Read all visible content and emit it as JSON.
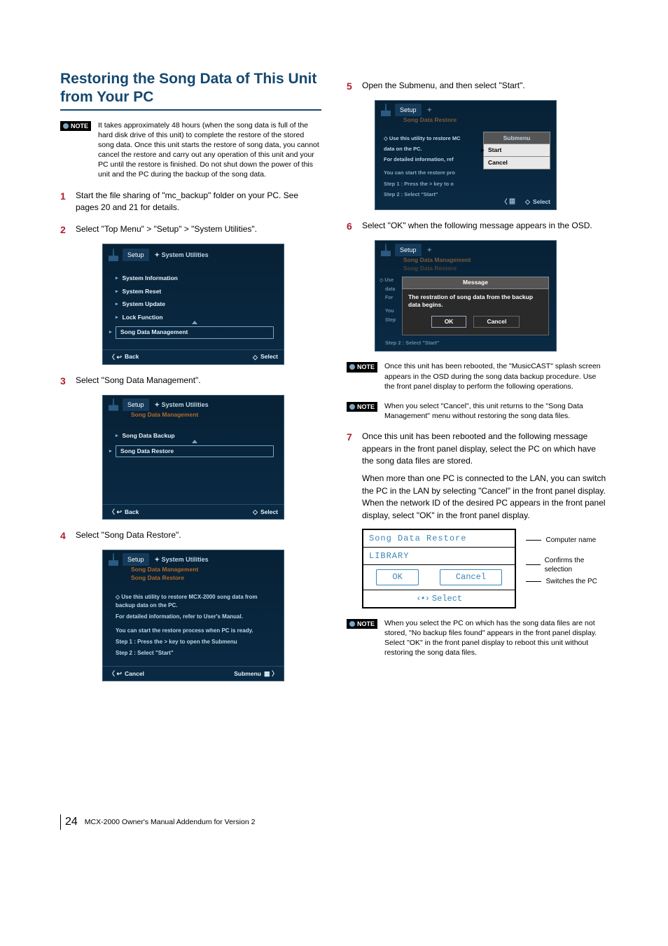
{
  "heading": "Restoring the Song Data of This Unit from Your PC",
  "noteBadge": "NOTE",
  "notes": {
    "intro": "It takes approximately 48 hours (when the song data is full of the hard disk drive of this unit) to complete the restore of the stored song data. Once this unit starts the restore of song data, you cannot cancel the restore and carry out any operation of this unit and your PC until the restore is finished. Do not shut down the power of this unit and the PC during the backup of the song data.",
    "afterReboot": "Once this unit has been rebooted, the \"MusicCAST\" splash screen appears in the OSD during the song data backup procedure. Use the front panel display to perform the following operations.",
    "cancel": "When you select \"Cancel\", this unit returns to the \"Song Data Management\" menu without restoring the song data files.",
    "noBackup": "When you select the PC on which has the song data files are not stored, \"No backup files found\" appears in the front panel display. Select \"OK\" in the front panel display to reboot this unit without restoring the song data files."
  },
  "steps": {
    "s1": "Start the file sharing of \"mc_backup\" folder on your PC. See pages 20 and 21 for details.",
    "s2": "Select \"Top Menu\" > \"Setup\" > \"System Utilities\".",
    "s3": "Select \"Song Data Management\".",
    "s4": "Select \"Song Data Restore\".",
    "s5": "Open the Submenu, and then select \"Start\".",
    "s6": "Select \"OK\" when the following message appears in the OSD.",
    "s7a": "Once this unit has been rebooted and the following message appears in the front panel display, select the PC on which have the song data files are stored.",
    "s7b": "When more than one PC is connected to the LAN, you can switch the PC in the LAN by selecting \"Cancel\" in the front panel display. When the network ID of the desired PC appears in the front panel display, select \"OK\" in the front panel display."
  },
  "osd": {
    "tabSetup": "Setup",
    "tabSysUtil": "System Utilities",
    "tabSDM": "Song Data Management",
    "tabSDR": "Song Data Restore",
    "menu1": [
      "System Information",
      "System Reset",
      "System Update",
      "Lock Function",
      "Song Data Management"
    ],
    "menu2": [
      "Song Data Backup",
      "Song Data Restore"
    ],
    "restoreDesc1": "Use this utility to restore MCX-2000 song data from backup data on the PC.",
    "restoreDesc2": "For detailed information, refer to User's Manual.",
    "restoreDesc3": "You can start the restore process when PC is ready.",
    "restoreDesc4": "Step 1 : Press the > key to open the Submenu",
    "restoreDesc5": "Step 2 : Select \"Start\"",
    "submenuShort1": "Use this utility to restore MC",
    "submenuShort2": "data on the PC.",
    "submenuShort3": "For detailed information, ref",
    "submenuShort4": "You can start the restore pro",
    "submenuShort5": "Step 1 : Press the > key to o",
    "submenuShort6": "Step 2 : Select \"Start\"",
    "submenuHeader": "Submenu",
    "submenuItems": [
      "Start",
      "Cancel"
    ],
    "back": "Back",
    "select": "Select",
    "cancel": "Cancel",
    "submenu": "Submenu",
    "msgHeader": "Message",
    "msgText": "The restration of song data from the backup data begins.",
    "msgOk": "OK",
    "msgCancel": "Cancel",
    "msgSideUse": "Use",
    "msgSideData": "data",
    "msgSideFor": "For",
    "msgSideYou": "You",
    "msgSideStep": "Step",
    "msgFooterStep": "Step 2 : Select \"Start\""
  },
  "frontPanel": {
    "title": "Song Data Restore",
    "pcName": "LIBRARY",
    "ok": "OK",
    "cancel": "Cancel",
    "select": "Select",
    "labelComputer": "Computer name",
    "labelConfirm": "Confirms the selection",
    "labelSwitch": "Switches the PC"
  },
  "page": {
    "num": "24",
    "title": "MCX-2000 Owner's Manual Addendum for Version 2"
  }
}
